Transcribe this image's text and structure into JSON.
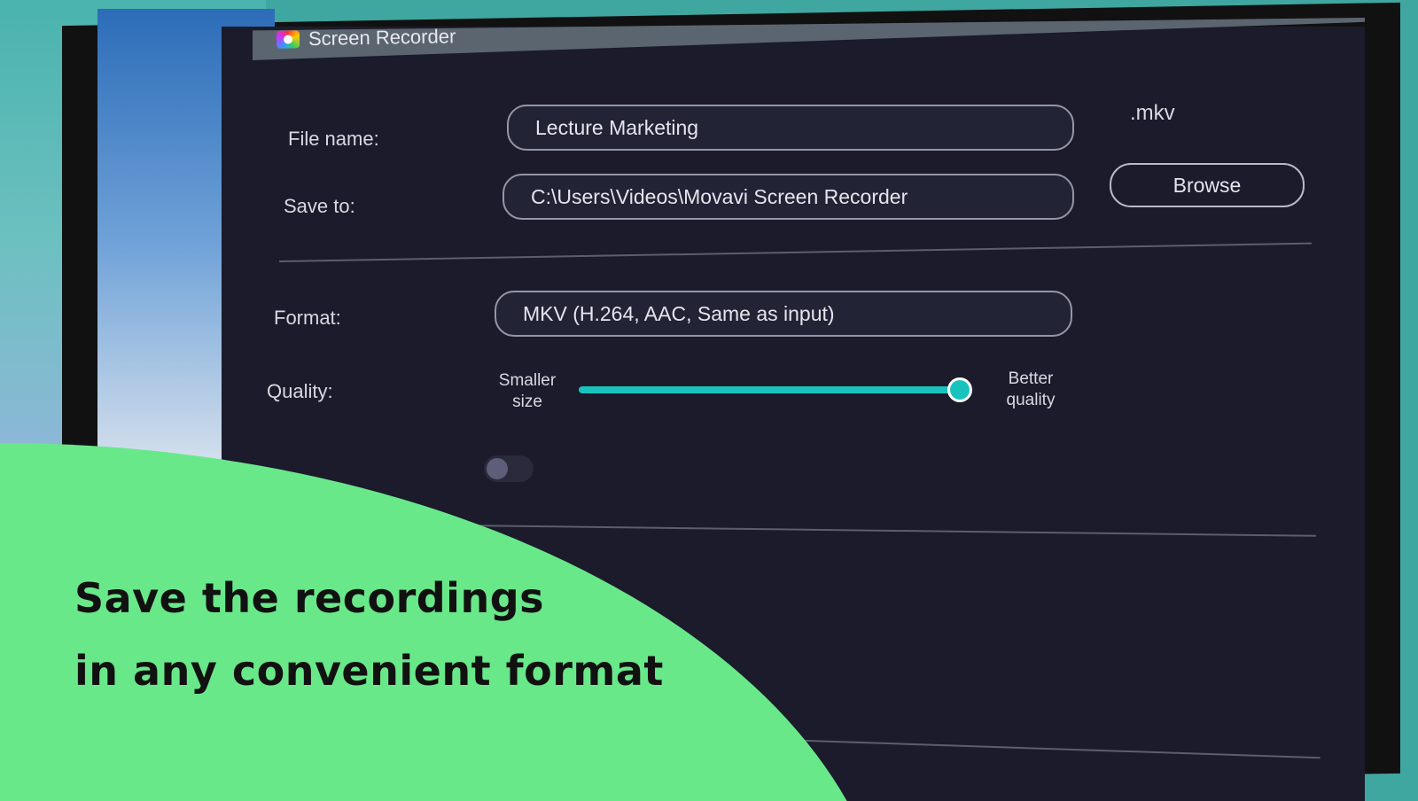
{
  "window": {
    "title": "Screen Recorder"
  },
  "file_name": {
    "label": "File name:",
    "value": "Lecture Marketing",
    "extension": ".mkv"
  },
  "save_to": {
    "label": "Save to:",
    "value": "C:\\Users\\Videos\\Movavi Screen Recorder",
    "browse_label": "Browse"
  },
  "format": {
    "label": "Format:",
    "value": "MKV (H.264, AAC, Same as input)"
  },
  "quality": {
    "label": "Quality:",
    "min_label": "Smaller size",
    "max_label": "Better quality",
    "value_percent": 100
  },
  "toggle": {
    "on": false
  },
  "promo": {
    "line1": "Save the recordings",
    "line2": "in any convenient format"
  },
  "colors": {
    "accent": "#19c3bd",
    "promo_green": "#69e88a",
    "window_bg": "#1b1b2b"
  }
}
